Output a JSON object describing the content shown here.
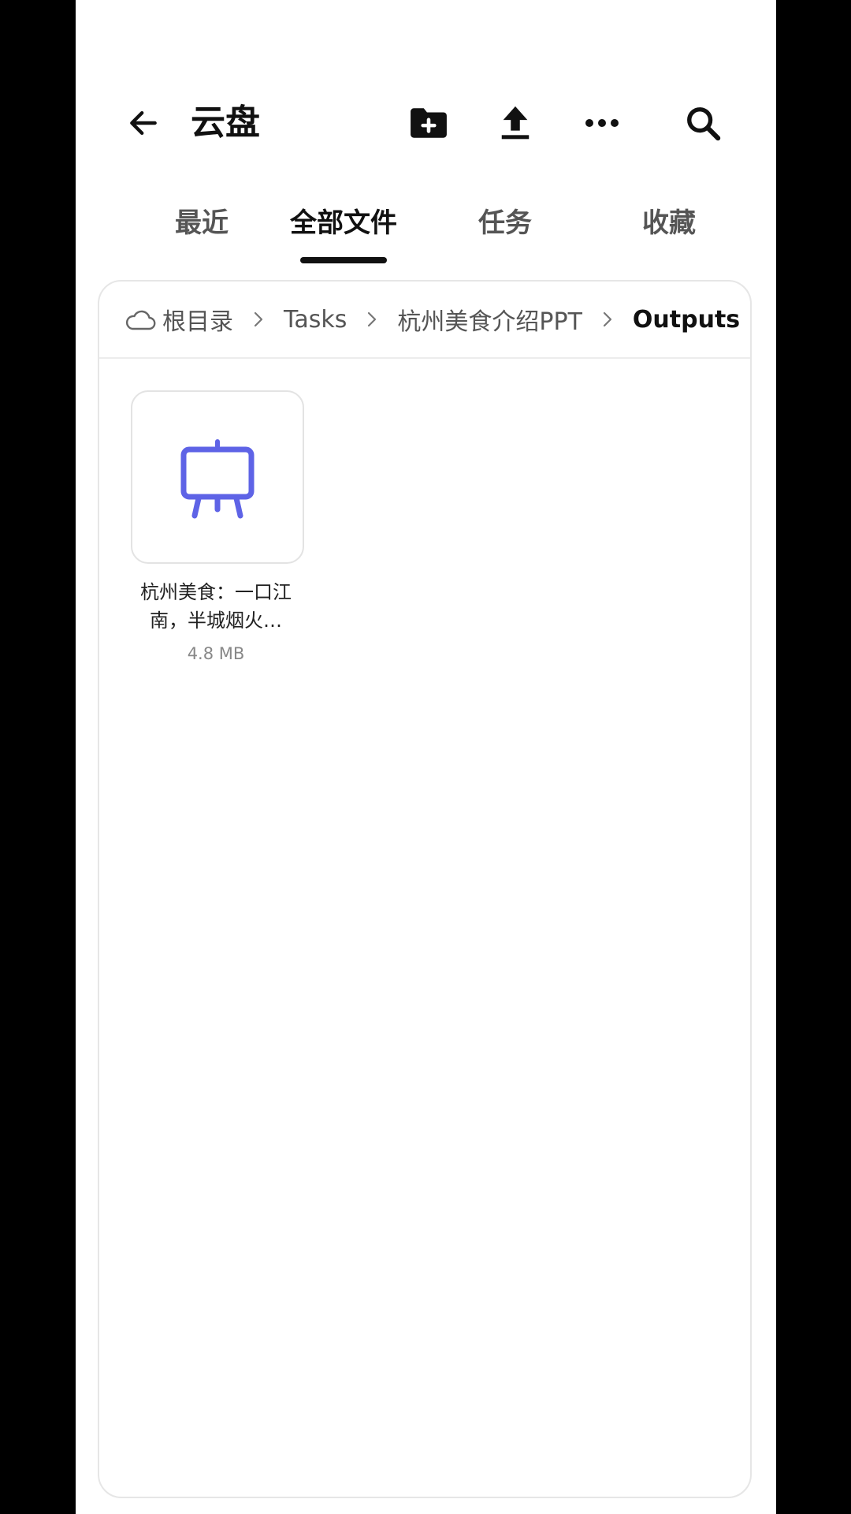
{
  "header": {
    "title": "云盘",
    "icons": {
      "back": "arrow-left-icon",
      "new_folder": "folder-plus-icon",
      "upload": "upload-icon",
      "more": "more-horizontal-icon",
      "search": "search-icon"
    }
  },
  "tabs": [
    {
      "label": "最近",
      "active": false
    },
    {
      "label": "全部文件",
      "active": true
    },
    {
      "label": "任务",
      "active": false
    },
    {
      "label": "收藏",
      "active": false
    }
  ],
  "breadcrumb": {
    "root": "根目录",
    "items": [
      "Tasks",
      "杭州美食介绍PPT"
    ],
    "current": "Outputs"
  },
  "files": [
    {
      "name": "杭州美食：一口江南，半城烟火…",
      "size": "4.8 MB",
      "icon": "presentation-easel-icon"
    }
  ],
  "colors": {
    "accent": "#5e63e6",
    "text_primary": "#111111",
    "text_secondary": "#555555",
    "text_muted": "#888888"
  }
}
